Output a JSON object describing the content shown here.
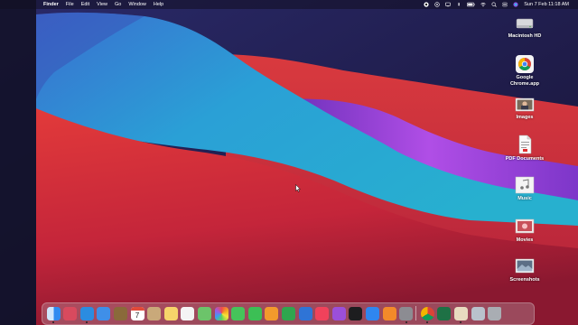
{
  "menubar": {
    "apple_glyph": "",
    "items": [
      "Finder",
      "File",
      "Edit",
      "View",
      "Go",
      "Window",
      "Help"
    ],
    "clock": "Sun 7 Feb  11:18 AM"
  },
  "desktop_items": [
    {
      "label": "Macintosh HD",
      "icon": "hard-drive-icon"
    },
    {
      "label": "Google Chrome.app",
      "icon": "chrome-icon"
    },
    {
      "label": "Images",
      "icon": "images-folder-icon"
    },
    {
      "label": "PDF Documents",
      "icon": "pdf-documents-icon"
    },
    {
      "label": "Music",
      "icon": "music-folder-icon"
    },
    {
      "label": "Movies",
      "icon": "movies-folder-icon"
    },
    {
      "label": "Screenshots",
      "icon": "screenshots-folder-icon"
    }
  ],
  "dock": {
    "calendar_day": "7",
    "apps": [
      {
        "icon": "finder-icon",
        "color": "#2f8bf0"
      },
      {
        "icon": "launchpad-icon",
        "color": "#d84a5e"
      },
      {
        "icon": "safari-icon",
        "color": "#2b8ce0"
      },
      {
        "icon": "mail-icon",
        "color": "#3f8fe8"
      },
      {
        "icon": "notes-brown-icon",
        "color": "#8a6a3a"
      },
      {
        "icon": "calendar-icon",
        "color": "#ffffff"
      },
      {
        "icon": "contacts-icon",
        "color": "#c9a97a"
      },
      {
        "icon": "notes-icon",
        "color": "#f6d46a"
      },
      {
        "icon": "reminders-icon",
        "color": "#f4f4f4"
      },
      {
        "icon": "maps-icon",
        "color": "#6cc46a"
      },
      {
        "icon": "photos-icon",
        "color": "#f4f4f4"
      },
      {
        "icon": "messages-icon",
        "color": "#46c45a"
      },
      {
        "icon": "facetime-icon",
        "color": "#3cbf55"
      },
      {
        "icon": "pages-icon",
        "color": "#f39a2c"
      },
      {
        "icon": "numbers-icon",
        "color": "#2fa64e"
      },
      {
        "icon": "keynote-icon",
        "color": "#2f74d6"
      },
      {
        "icon": "music-icon",
        "color": "#f0425b"
      },
      {
        "icon": "podcasts-icon",
        "color": "#9b4fd9"
      },
      {
        "icon": "apple-tv-icon",
        "color": "#1d1d1f"
      },
      {
        "icon": "app-store-icon",
        "color": "#2f86ef"
      },
      {
        "icon": "books-icon",
        "color": "#f28a2a"
      },
      {
        "icon": "system-preferences-icon",
        "color": "#8c8c92"
      },
      {
        "icon": "chrome-icon",
        "color": "#f4f4f4"
      },
      {
        "icon": "excel-icon",
        "color": "#1e7145"
      },
      {
        "icon": "preview-icon",
        "color": "#e8dcc0"
      },
      {
        "icon": "finder-window-icon",
        "color": "#b9c2cc"
      },
      {
        "icon": "trash-icon",
        "color": "#a9adb3"
      }
    ]
  },
  "colors": {
    "wallpaper_red": "#c8283a",
    "wallpaper_blue": "#2a9bd8",
    "wallpaper_purple": "#9b3fd8",
    "wallpaper_navy": "#1b1638"
  }
}
